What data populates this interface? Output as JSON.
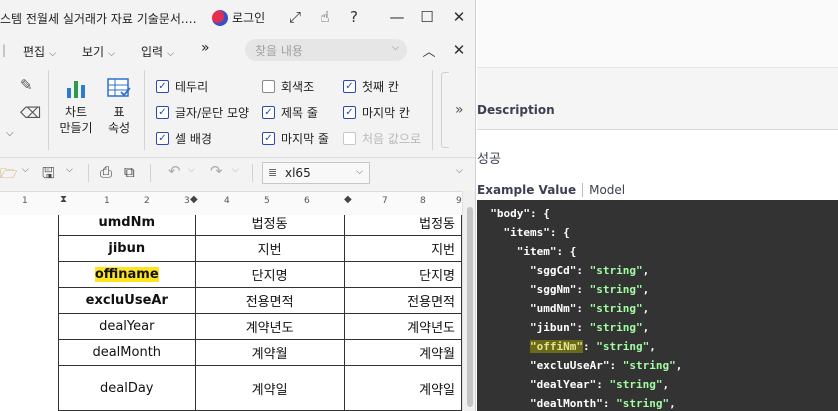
{
  "window": {
    "title": "스템 전월세 실거래가 자료 기술문서.…",
    "login_label": "로그인"
  },
  "menubar": {
    "items": [
      "편집",
      "보기",
      "입력"
    ],
    "more": "»",
    "search_placeholder": "찾을 내용"
  },
  "ribbon": {
    "chart_label_1": "차트",
    "chart_label_2": "만들기",
    "table_label_1": "표",
    "table_label_2": "속성",
    "checks": [
      {
        "label": "테두리",
        "state": "on"
      },
      {
        "label": "회색조",
        "state": "off"
      },
      {
        "label": "첫째 칸",
        "state": "on"
      },
      {
        "label": "글자/문단 모양",
        "state": "on"
      },
      {
        "label": "제목 줄",
        "state": "on"
      },
      {
        "label": "마지막 칸",
        "state": "on"
      },
      {
        "label": "셀 배경",
        "state": "on"
      },
      {
        "label": "마지막 줄",
        "state": "on"
      },
      {
        "label": "처음 값으로",
        "state": "disabled"
      }
    ]
  },
  "toolbar": {
    "style_value": "xl65"
  },
  "ruler": {
    "ticks": [
      "1",
      "1",
      "2",
      "3",
      "4",
      "5",
      "6",
      "7",
      "8",
      "9"
    ]
  },
  "doc_table": {
    "rows": [
      {
        "field": "umdNm",
        "name": "법정동",
        "desc": "법정동",
        "style": "bold"
      },
      {
        "field": "jibun",
        "name": "지번",
        "desc": "지번",
        "style": "bold"
      },
      {
        "field": "offiname",
        "name": "단지명",
        "desc": "단지명",
        "style": "bold-highlight"
      },
      {
        "field": "excluUseAr",
        "name": "전용면적",
        "desc": "전용면적",
        "style": "bold"
      },
      {
        "field": "dealYear",
        "name": "계약년도",
        "desc": "계약년도",
        "style": "normal"
      },
      {
        "field": "dealMonth",
        "name": "계약월",
        "desc": "계약월",
        "style": "normal"
      },
      {
        "field": "dealDay",
        "name": "계약일",
        "desc": "계약일",
        "style": "normal-tall"
      }
    ]
  },
  "api_panel": {
    "description_header": "Description",
    "response_description": "성공",
    "tab_example": "Example Value",
    "tab_model": "Model",
    "code_lines": [
      {
        "indent": "  ",
        "key": "\"body\"",
        "sep": ": {",
        "value": ""
      },
      {
        "indent": "    ",
        "key": "\"items\"",
        "sep": ": {",
        "value": ""
      },
      {
        "indent": "      ",
        "key": "\"item\"",
        "sep": ": {",
        "value": ""
      },
      {
        "indent": "        ",
        "key": "\"sggCd\"",
        "sep": ": ",
        "value": "\"string\"",
        "tail": ","
      },
      {
        "indent": "        ",
        "key": "\"sggNm\"",
        "sep": ": ",
        "value": "\"string\"",
        "tail": ","
      },
      {
        "indent": "        ",
        "key": "\"umdNm\"",
        "sep": ": ",
        "value": "\"string\"",
        "tail": ","
      },
      {
        "indent": "        ",
        "key": "\"jibun\"",
        "sep": ": ",
        "value": "\"string\"",
        "tail": ","
      },
      {
        "indent": "        ",
        "key": "\"offiNm\"",
        "sep": ": ",
        "value": "\"string\"",
        "tail": ",",
        "highlight": true
      },
      {
        "indent": "        ",
        "key": "\"excluUseAr\"",
        "sep": ": ",
        "value": "\"string\"",
        "tail": ","
      },
      {
        "indent": "        ",
        "key": "\"dealYear\"",
        "sep": ": ",
        "value": "\"string\"",
        "tail": ","
      },
      {
        "indent": "        ",
        "key": "\"dealMonth\"",
        "sep": ": ",
        "value": "\"string\"",
        "tail": ","
      }
    ]
  },
  "colors": {
    "code_bg": "#333333",
    "code_string": "#a2fca2",
    "highlight_yellow": "#ffe51f",
    "checkbox_accent": "#2d48b5"
  }
}
